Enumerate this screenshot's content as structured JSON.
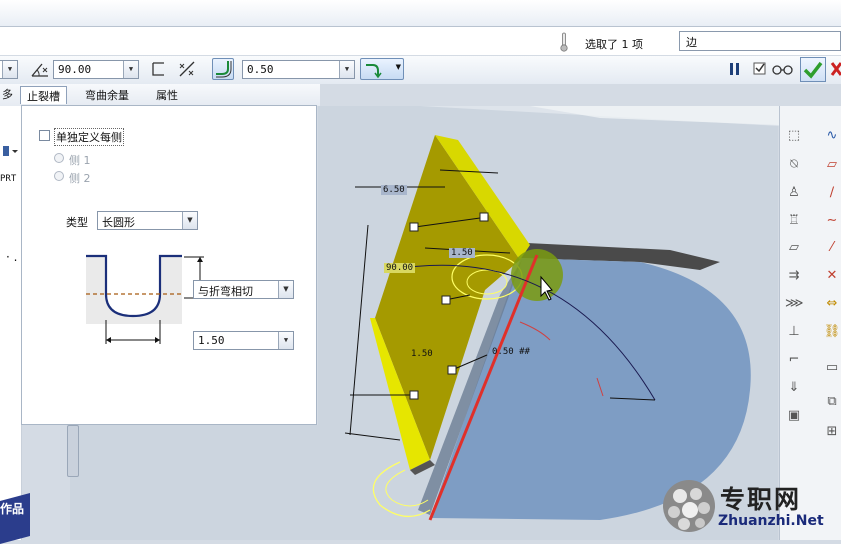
{
  "status": {
    "selected_text": "选取了 1 项",
    "edge_value": "边"
  },
  "toolbar": {
    "left_value": "",
    "angle_value": "90.00",
    "radius_value": "0.50"
  },
  "tabs": [
    {
      "label": "止裂槽",
      "active": true
    },
    {
      "label": "弯曲余量",
      "active": false
    },
    {
      "label": "属性",
      "active": false
    }
  ],
  "panel": {
    "checkbox_label": "单独定义每侧",
    "radio_side1": "侧 1",
    "radio_side2": "侧 2",
    "type_label": "类型",
    "type_value": "长圆形",
    "tangent_value": "与折弯相切",
    "width_value": "1.50"
  },
  "left_fragments": {
    "prt": "PRT",
    "dots": "· ."
  },
  "dimensions": {
    "d1": "6.50",
    "d2": "1.50",
    "d3": "90.00",
    "d4": "1.50",
    "d5": "0.50 ##"
  },
  "watermark": {
    "brand": "专职网",
    "url": "Zhuanzhi.Net",
    "corner": "作品"
  },
  "colors": {
    "accent_yellow": "#e6e600",
    "edge_red": "#e0302a",
    "surface_blue": "#7e9dc4",
    "ok_green": "#2e9e2e",
    "cancel_red": "#cc2222"
  }
}
